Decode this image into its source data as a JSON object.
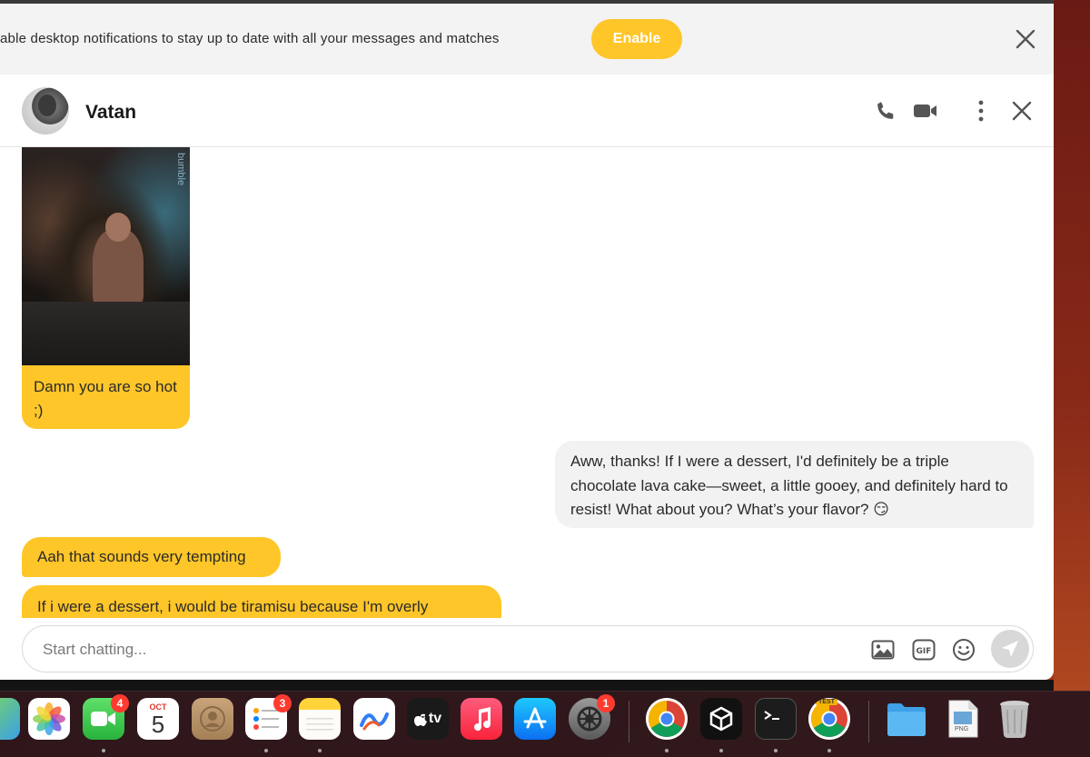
{
  "notification": {
    "text": "able desktop notifications to stay up to date with all your messages and matches",
    "enable_label": "Enable"
  },
  "chat": {
    "contact_name": "Vatan",
    "header_icons": [
      "phone-icon",
      "video-camera-icon",
      "more-vertical-icon",
      "close-icon"
    ],
    "photo_watermark": "bumble",
    "messages": [
      {
        "direction": "incoming",
        "type": "photo",
        "caption": "Damn you are so hot ;)"
      },
      {
        "direction": "outgoing",
        "text": "Aww, thanks! If I were a dessert, I'd definitely be a triple chocolate lava cake—sweet, a little gooey, and definitely hard to resist! What about you? What’s your flavor? 😏"
      },
      {
        "direction": "incoming",
        "text": "Aah that sounds very tempting"
      },
      {
        "direction": "incoming",
        "text": "If i were a dessert, i would be tiramisu because I'm overly"
      }
    ],
    "input": {
      "placeholder": "Start chatting...",
      "value": "",
      "icons": [
        "image-icon",
        "gif-icon",
        "emoji-icon",
        "send-icon"
      ],
      "gif_label": "GIF"
    }
  },
  "dock": {
    "apps": [
      {
        "name": "Maps",
        "icon": "maps-icon"
      },
      {
        "name": "Photos",
        "icon": "photos-icon"
      },
      {
        "name": "FaceTime",
        "icon": "facetime-icon",
        "badge": "4"
      },
      {
        "name": "Calendar",
        "icon": "calendar-icon",
        "month": "OCT",
        "day": "5"
      },
      {
        "name": "Contacts",
        "icon": "contacts-icon"
      },
      {
        "name": "Reminders",
        "icon": "reminders-icon",
        "badge": "3"
      },
      {
        "name": "Notes",
        "icon": "notes-icon"
      },
      {
        "name": "Freeform",
        "icon": "freeform-icon"
      },
      {
        "name": "TV",
        "icon": "apple-tv-icon",
        "label": "tv"
      },
      {
        "name": "Music",
        "icon": "music-icon"
      },
      {
        "name": "App Store",
        "icon": "app-store-icon"
      },
      {
        "name": "System Settings",
        "icon": "settings-icon",
        "badge": "1"
      },
      {
        "name": "Chrome",
        "icon": "chrome-icon"
      },
      {
        "name": "Unity",
        "icon": "unity-icon"
      },
      {
        "name": "Terminal",
        "icon": "terminal-icon"
      },
      {
        "name": "Chrome Canary",
        "icon": "chrome-test-icon",
        "label": "TEST"
      },
      {
        "name": "Downloads",
        "icon": "folder-icon"
      },
      {
        "name": "PNG file",
        "icon": "png-file-icon",
        "label": "PNG"
      },
      {
        "name": "Trash",
        "icon": "trash-icon"
      }
    ]
  },
  "colors": {
    "accent_yellow": "#ffc629",
    "outgoing_bubble": "#f2f2f2",
    "badge_red": "#ff3b30"
  }
}
